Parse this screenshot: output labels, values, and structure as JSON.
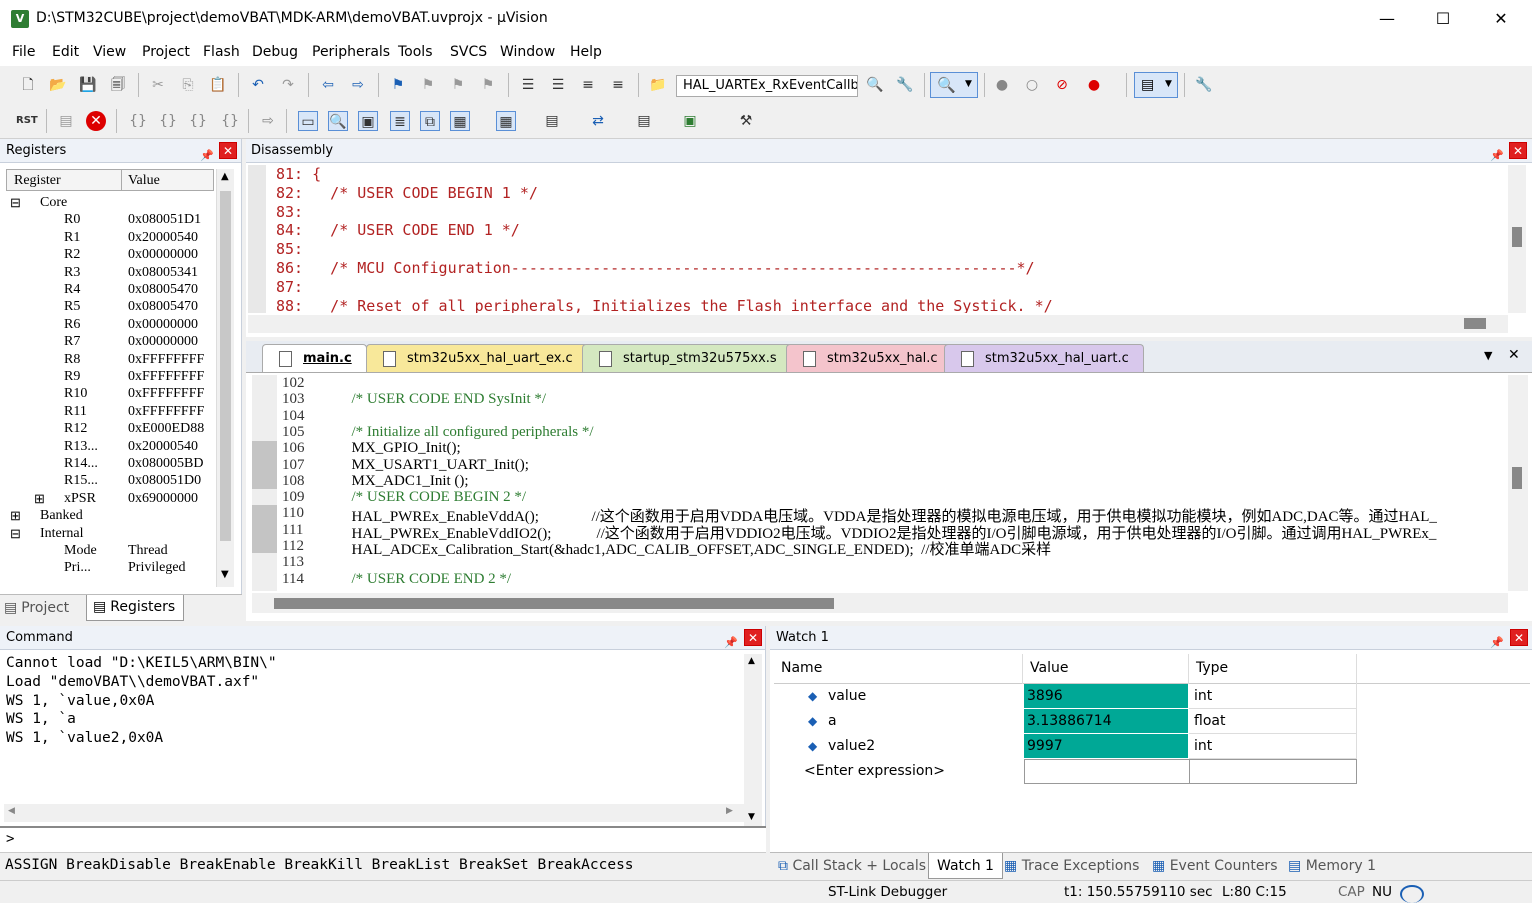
{
  "window": {
    "title": "D:\\STM32CUBE\\project\\demoVBAT\\MDK-ARM\\demoVBAT.uvprojx - µVision",
    "minimize": "—",
    "maximize": "☐",
    "close": "✕"
  },
  "menu": [
    "File",
    "Edit",
    "View",
    "Project",
    "Flash",
    "Debug",
    "Peripherals",
    "Tools",
    "SVCS",
    "Window",
    "Help"
  ],
  "toolbar": {
    "function_combo": "HAL_UARTEx_RxEventCallba"
  },
  "registers": {
    "title": "Registers",
    "col_register": "Register",
    "col_value": "Value",
    "rows": [
      {
        "name": "Core",
        "value": ""
      },
      {
        "name": "R0",
        "value": "0x080051D1"
      },
      {
        "name": "R1",
        "value": "0x20000540"
      },
      {
        "name": "R2",
        "value": "0x00000000"
      },
      {
        "name": "R3",
        "value": "0x08005341"
      },
      {
        "name": "R4",
        "value": "0x08005470"
      },
      {
        "name": "R5",
        "value": "0x08005470"
      },
      {
        "name": "R6",
        "value": "0x00000000"
      },
      {
        "name": "R7",
        "value": "0x00000000"
      },
      {
        "name": "R8",
        "value": "0xFFFFFFFF"
      },
      {
        "name": "R9",
        "value": "0xFFFFFFFF"
      },
      {
        "name": "R10",
        "value": "0xFFFFFFFF"
      },
      {
        "name": "R11",
        "value": "0xFFFFFFFF"
      },
      {
        "name": "R12",
        "value": "0xE000ED88"
      },
      {
        "name": "R13...",
        "value": "0x20000540"
      },
      {
        "name": "R14...",
        "value": "0x080005BD"
      },
      {
        "name": "R15...",
        "value": "0x080051D0"
      },
      {
        "name": "xPSR",
        "value": "0x69000000"
      },
      {
        "name": "Banked",
        "value": ""
      },
      {
        "name": "Internal",
        "value": ""
      },
      {
        "name": "Mode",
        "value": "Thread"
      },
      {
        "name": "Pri...",
        "value": "Privileged"
      }
    ],
    "tab_project": "Project",
    "tab_registers": "Registers"
  },
  "disassembly": {
    "title": "Disassembly",
    "lines": [
      "81: {",
      "82:   /* USER CODE BEGIN 1 */",
      "83: ",
      "84:   /* USER CODE END 1 */",
      "85: ",
      "86:   /* MCU Configuration--------------------------------------------------------*/",
      "87: ",
      "88:   /* Reset of all peripherals, Initializes the Flash interface and the Systick. */"
    ]
  },
  "editor": {
    "tabs": [
      "main.c",
      "stm32u5xx_hal_uart_ex.c",
      "startup_stm32u575xx.s",
      "stm32u5xx_hal.c",
      "stm32u5xx_hal_uart.c"
    ],
    "tab_colors": [
      "#ffffff",
      "#f8e89a",
      "#d4e8c0",
      "#f4c4cc",
      "#d8c8ec"
    ],
    "line_numbers": [
      "102",
      "103",
      "104",
      "105",
      "106",
      "107",
      "108",
      "109",
      "110",
      "111",
      "112",
      "113",
      "114"
    ],
    "lines": [
      "",
      "  /* USER CODE END SysInit */",
      "",
      "  /* Initialize all configured peripherals */",
      "  MX_GPIO_Init();",
      "  MX_USART1_UART_Init();",
      "  MX_ADC1_Init ();",
      "  /* USER CODE BEGIN 2 */",
      "  HAL_PWREx_EnableVddA();              //这个函数用于启用VDDA电压域。VDDA是指处理器的模拟电源电压域，用于供电模拟功能模块，例如ADC,DAC等。通过HAL_",
      "  HAL_PWREx_EnableVddIO2();            //这个函数用于启用VDDIO2电压域。VDDIO2是指处理器的I/O引脚电源域，用于供电处理器的I/O引脚。通过调用HAL_PWREx_",
      "  HAL_ADCEx_Calibration_Start(&hadc1,ADC_CALIB_OFFSET,ADC_SINGLE_ENDED);  //校准单端ADC采样",
      "",
      "  /* USER CODE END 2 */"
    ]
  },
  "command": {
    "title": "Command",
    "lines": [
      "Cannot load \"D:\\KEIL5\\ARM\\BIN\\\"",
      "Load \"demoVBAT\\\\demoVBAT.axf\"",
      "WS 1, `value,0x0A",
      "WS 1, `a",
      "WS 1, `value2,0x0A"
    ],
    "prompt": ">",
    "hint": "ASSIGN BreakDisable BreakEnable BreakKill BreakList BreakSet BreakAccess"
  },
  "watch": {
    "title": "Watch 1",
    "col_name": "Name",
    "col_value": "Value",
    "col_type": "Type",
    "rows": [
      {
        "name": "value",
        "value": "3896",
        "type": "int"
      },
      {
        "name": "a",
        "value": "3.13886714",
        "type": "float"
      },
      {
        "name": "value2",
        "value": "9997",
        "type": "int"
      }
    ],
    "enter_expression": "<Enter expression>",
    "tabs": [
      "Call Stack + Locals",
      "Watch 1",
      "Trace Exceptions",
      "Event Counters",
      "Memory 1"
    ]
  },
  "status": {
    "debugger": "ST-Link Debugger",
    "time": "t1: 150.55759110 sec",
    "position": "L:80 C:15",
    "cap": "CAP",
    "num": "NU"
  },
  "colors": {
    "accent_watch": "#00a896",
    "comment_red": "#b22222",
    "comment_blue": "#1a3fa0",
    "code_green": "#2e7d32"
  }
}
